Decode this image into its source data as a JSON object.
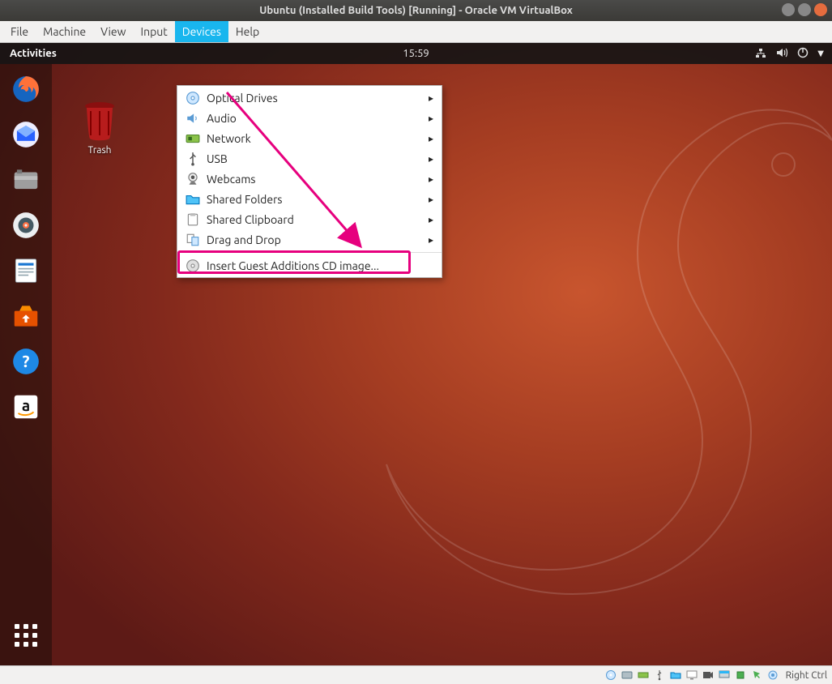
{
  "window": {
    "title": "Ubuntu (Installed Build Tools) [Running] - Oracle VM VirtualBox"
  },
  "menubar": {
    "items": [
      "File",
      "Machine",
      "View",
      "Input",
      "Devices",
      "Help"
    ],
    "active": "Devices"
  },
  "dropdown": {
    "items": [
      {
        "icon": "disc-icon",
        "label": "Optical Drives",
        "submenu": true
      },
      {
        "icon": "sound-icon",
        "label": "Audio",
        "submenu": true
      },
      {
        "icon": "network-card-icon",
        "label": "Network",
        "submenu": true
      },
      {
        "icon": "usb-icon",
        "label": "USB",
        "submenu": true
      },
      {
        "icon": "webcam-icon",
        "label": "Webcams",
        "submenu": true
      },
      {
        "icon": "folder-share-icon",
        "label": "Shared Folders",
        "submenu": true
      },
      {
        "icon": "clipboard-icon",
        "label": "Shared Clipboard",
        "submenu": true
      },
      {
        "icon": "drag-drop-icon",
        "label": "Drag and Drop",
        "submenu": true
      }
    ],
    "last": {
      "icon": "cd-insert-icon",
      "label": "Insert Guest Additions CD image..."
    }
  },
  "ubuntu": {
    "activities": "Activities",
    "clock": "15:59",
    "trash_label": "Trash"
  },
  "statusbar": {
    "host_key": "Right Ctrl"
  }
}
